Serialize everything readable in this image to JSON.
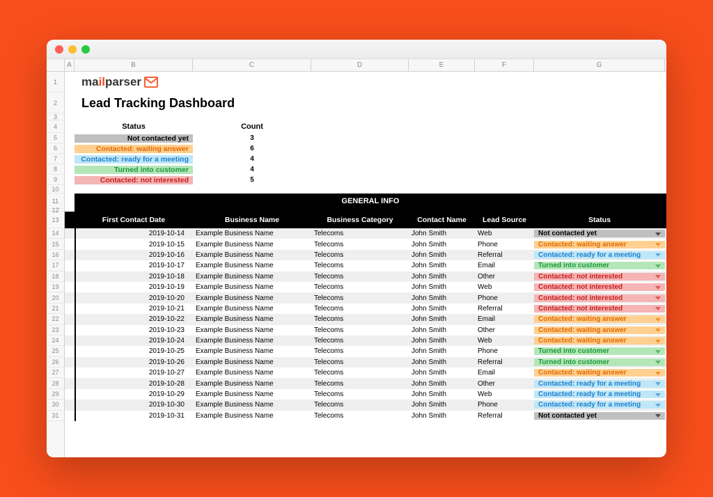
{
  "window": {
    "os": "mac"
  },
  "logo": {
    "part1": "ma",
    "part2": "il",
    "part3": "parser"
  },
  "title": "Lead Tracking Dashboard",
  "columns": [
    "A",
    "B",
    "C",
    "D",
    "E",
    "F",
    "G"
  ],
  "row_numbers": [
    1,
    2,
    3,
    4,
    5,
    6,
    7,
    8,
    9,
    10,
    11,
    12,
    13,
    14,
    15,
    16,
    17,
    18,
    19,
    20,
    21,
    22,
    23,
    24,
    25,
    26,
    27,
    28,
    29,
    30,
    31
  ],
  "summary": {
    "headers": [
      "Status",
      "Count"
    ],
    "rows": [
      {
        "label": "Not contacted yet",
        "count": 3,
        "style": "not"
      },
      {
        "label": "Contacted: waiting answer",
        "count": 6,
        "style": "wait"
      },
      {
        "label": "Contacted: ready for a meeting",
        "count": 4,
        "style": "meet"
      },
      {
        "label": "Turned into customer",
        "count": 4,
        "style": "cust"
      },
      {
        "label": "Contacted: not interested",
        "count": 5,
        "style": "nint"
      }
    ]
  },
  "band_title": "GENERAL INFO",
  "table": {
    "headers": [
      "First Contact Date",
      "Business Name",
      "Business Category",
      "Contact Name",
      "Lead Source",
      "Status"
    ],
    "rows": [
      {
        "date": "2019-10-14",
        "biz": "Example Business Name",
        "cat": "Telecoms",
        "contact": "John Smith",
        "src": "Web",
        "status": "Not contacted yet",
        "style": "not"
      },
      {
        "date": "2019-10-15",
        "biz": "Example Business Name",
        "cat": "Telecoms",
        "contact": "John Smith",
        "src": "Phone",
        "status": "Contacted: waiting answer",
        "style": "wait"
      },
      {
        "date": "2019-10-16",
        "biz": "Example Business Name",
        "cat": "Telecoms",
        "contact": "John Smith",
        "src": "Referral",
        "status": "Contacted: ready for a meeting",
        "style": "meet"
      },
      {
        "date": "2019-10-17",
        "biz": "Example Business Name",
        "cat": "Telecoms",
        "contact": "John Smith",
        "src": "Email",
        "status": "Turned into customer",
        "style": "cust"
      },
      {
        "date": "2019-10-18",
        "biz": "Example Business Name",
        "cat": "Telecoms",
        "contact": "John Smith",
        "src": "Other",
        "status": "Contacted: not interested",
        "style": "nint"
      },
      {
        "date": "2019-10-19",
        "biz": "Example Business Name",
        "cat": "Telecoms",
        "contact": "John Smith",
        "src": "Web",
        "status": "Contacted: not interested",
        "style": "nint"
      },
      {
        "date": "2019-10-20",
        "biz": "Example Business Name",
        "cat": "Telecoms",
        "contact": "John Smith",
        "src": "Phone",
        "status": "Contacted: not interested",
        "style": "nint"
      },
      {
        "date": "2019-10-21",
        "biz": "Example Business Name",
        "cat": "Telecoms",
        "contact": "John Smith",
        "src": "Referral",
        "status": "Contacted: not interested",
        "style": "nint"
      },
      {
        "date": "2019-10-22",
        "biz": "Example Business Name",
        "cat": "Telecoms",
        "contact": "John Smith",
        "src": "Email",
        "status": "Contacted: waiting answer",
        "style": "wait"
      },
      {
        "date": "2019-10-23",
        "biz": "Example Business Name",
        "cat": "Telecoms",
        "contact": "John Smith",
        "src": "Other",
        "status": "Contacted: waiting answer",
        "style": "wait"
      },
      {
        "date": "2019-10-24",
        "biz": "Example Business Name",
        "cat": "Telecoms",
        "contact": "John Smith",
        "src": "Web",
        "status": "Contacted: waiting answer",
        "style": "wait"
      },
      {
        "date": "2019-10-25",
        "biz": "Example Business Name",
        "cat": "Telecoms",
        "contact": "John Smith",
        "src": "Phone",
        "status": "Turned into customer",
        "style": "cust"
      },
      {
        "date": "2019-10-26",
        "biz": "Example Business Name",
        "cat": "Telecoms",
        "contact": "John Smith",
        "src": "Referral",
        "status": "Turned into customer",
        "style": "cust"
      },
      {
        "date": "2019-10-27",
        "biz": "Example Business Name",
        "cat": "Telecoms",
        "contact": "John Smith",
        "src": "Email",
        "status": "Contacted: waiting answer",
        "style": "wait"
      },
      {
        "date": "2019-10-28",
        "biz": "Example Business Name",
        "cat": "Telecoms",
        "contact": "John Smith",
        "src": "Other",
        "status": "Contacted: ready for a meeting",
        "style": "meet"
      },
      {
        "date": "2019-10-29",
        "biz": "Example Business Name",
        "cat": "Telecoms",
        "contact": "John Smith",
        "src": "Web",
        "status": "Contacted: ready for a meeting",
        "style": "meet"
      },
      {
        "date": "2019-10-30",
        "biz": "Example Business Name",
        "cat": "Telecoms",
        "contact": "John Smith",
        "src": "Phone",
        "status": "Contacted: ready for a meeting",
        "style": "meet"
      },
      {
        "date": "2019-10-31",
        "biz": "Example Business Name",
        "cat": "Telecoms",
        "contact": "John Smith",
        "src": "Referral",
        "status": "Not contacted yet",
        "style": "not"
      }
    ]
  }
}
